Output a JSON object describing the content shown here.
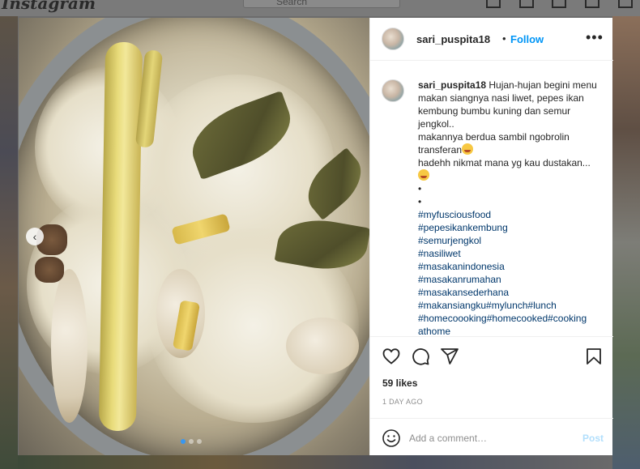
{
  "background": {
    "site_logo": "Instagram",
    "search_placeholder": "Search"
  },
  "post": {
    "carousel_prev_icon": "chevron-left-icon",
    "carousel_dots": 3,
    "carousel_active_dot": 1,
    "header": {
      "username": "sari_puspita18",
      "separator": "•",
      "follow_label": "Follow",
      "more_label": "•••"
    },
    "caption": {
      "username": "sari_puspita18",
      "text_line1": " Hujan-hujan begini menu makan siangnya nasi liwet, pepes ikan kembung bumbu kuning dan semur jengkol..",
      "text_line2": "makannya berdua sambil ngobrolin transferan",
      "text_line3": "hadehh nikmat mana yg kau dustakan...",
      "bullet1": "•",
      "bullet2": "•",
      "hashtags": [
        "#myfusciousfood",
        "#pepesikankembung",
        "#semurjengkol",
        "#nasiliwet",
        "#masakanindonesia",
        "#masakanrumahan",
        "#masakansederhana",
        "#makansiangku#mylunch#lunch",
        "#homecoooking#homecooked#cooking",
        "athome"
      ]
    },
    "likes": "59 likes",
    "time": "1 DAY AGO",
    "comment_placeholder": "Add a comment…",
    "post_label": "Post"
  },
  "colors": {
    "follow": "#0095f6",
    "hashtag": "#00376b",
    "post_disabled": "#b2dffc"
  }
}
